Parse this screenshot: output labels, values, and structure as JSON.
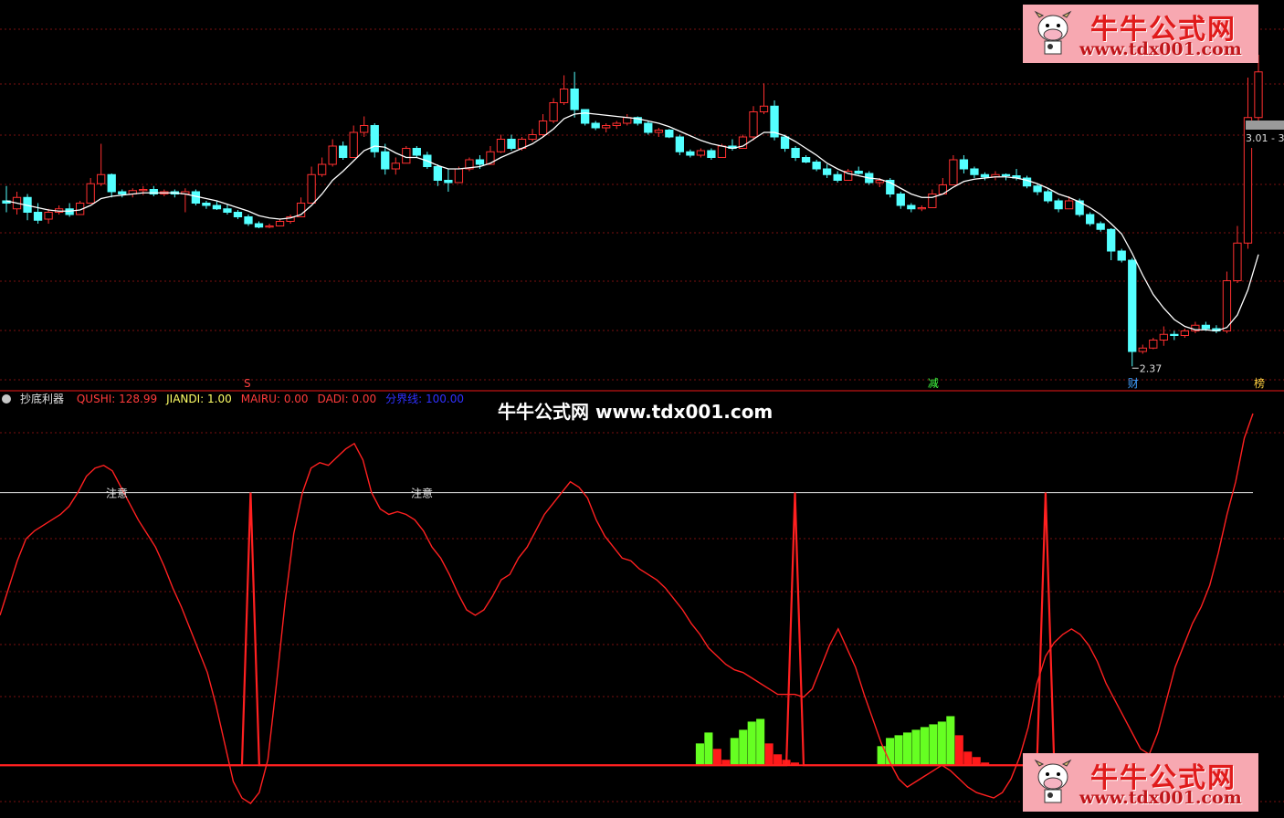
{
  "indicator": {
    "name": "抄底利器",
    "values": [
      {
        "label": "QUSHI: 128.99",
        "color": "#ff3b3b"
      },
      {
        "label": "JIANDI: 1.00",
        "color": "#ffff66"
      },
      {
        "label": "MAIRU: 0.00",
        "color": "#ff3b3b"
      },
      {
        "label": "DADI: 0.00",
        "color": "#ff3b3b"
      },
      {
        "label": "分界线: 100.00",
        "color": "#3030ff"
      }
    ]
  },
  "watermark": "牛牛公式网 www.tdx001.com",
  "logo": {
    "name": "牛牛公式网",
    "url": "www.tdx001.com"
  },
  "price_label": "3.01 - 3",
  "low_label": "2.37",
  "signals": [
    {
      "text": "S",
      "color": "#ff4040"
    },
    {
      "text": "减",
      "color": "#40ff40"
    },
    {
      "text": "财",
      "color": "#40a0ff"
    },
    {
      "text": "榜",
      "color": "#ffd040"
    }
  ],
  "annotations": [
    "注意",
    "注意"
  ],
  "colors": {
    "up": "#ff3030",
    "down": "#54ffff",
    "ma": "#ffffff",
    "grid": "#7a1010",
    "green": "#66ff22"
  },
  "chart_data": [
    {
      "type": "candlestick",
      "title": "",
      "ohlc": [
        [
          3.82,
          3.95,
          3.72,
          3.8
        ],
        [
          3.75,
          3.9,
          3.7,
          3.85
        ],
        [
          3.85,
          3.88,
          3.65,
          3.72
        ],
        [
          3.72,
          3.8,
          3.62,
          3.65
        ],
        [
          3.66,
          3.75,
          3.62,
          3.72
        ],
        [
          3.72,
          3.78,
          3.7,
          3.75
        ],
        [
          3.75,
          3.8,
          3.68,
          3.7
        ],
        [
          3.7,
          3.82,
          3.7,
          3.8
        ],
        [
          3.8,
          4.02,
          3.8,
          3.97
        ],
        [
          3.97,
          4.32,
          3.95,
          4.05
        ],
        [
          4.05,
          4.06,
          3.85,
          3.9
        ],
        [
          3.9,
          3.92,
          3.85,
          3.88
        ],
        [
          3.88,
          3.93,
          3.85,
          3.91
        ],
        [
          3.91,
          3.95,
          3.87,
          3.92
        ],
        [
          3.92,
          3.95,
          3.86,
          3.88
        ],
        [
          3.88,
          3.92,
          3.86,
          3.9
        ],
        [
          3.9,
          3.92,
          3.85,
          3.88
        ],
        [
          3.88,
          3.93,
          3.72,
          3.9
        ],
        [
          3.9,
          3.92,
          3.78,
          3.8
        ],
        [
          3.8,
          3.82,
          3.75,
          3.78
        ],
        [
          3.78,
          3.82,
          3.74,
          3.75
        ],
        [
          3.75,
          3.79,
          3.7,
          3.72
        ],
        [
          3.72,
          3.74,
          3.66,
          3.68
        ],
        [
          3.68,
          3.7,
          3.6,
          3.62
        ],
        [
          3.62,
          3.64,
          3.58,
          3.59
        ],
        [
          3.59,
          3.62,
          3.58,
          3.6
        ],
        [
          3.6,
          3.66,
          3.6,
          3.64
        ],
        [
          3.64,
          3.7,
          3.62,
          3.68
        ],
        [
          3.68,
          3.85,
          3.68,
          3.8
        ],
        [
          3.8,
          4.12,
          3.8,
          4.05
        ],
        [
          4.05,
          4.2,
          4.03,
          4.14
        ],
        [
          4.14,
          4.36,
          4.12,
          4.3
        ],
        [
          4.3,
          4.34,
          4.18,
          4.2
        ],
        [
          4.2,
          4.48,
          4.2,
          4.42
        ],
        [
          4.42,
          4.56,
          4.38,
          4.48
        ],
        [
          4.48,
          4.5,
          4.2,
          4.25
        ],
        [
          4.25,
          4.32,
          4.05,
          4.1
        ],
        [
          4.1,
          4.2,
          4.05,
          4.15
        ],
        [
          4.15,
          4.3,
          4.15,
          4.28
        ],
        [
          4.28,
          4.3,
          4.2,
          4.22
        ],
        [
          4.22,
          4.25,
          4.1,
          4.12
        ],
        [
          4.12,
          4.14,
          3.95,
          4.0
        ],
        [
          4.0,
          4.1,
          3.9,
          3.98
        ],
        [
          3.98,
          4.12,
          3.98,
          4.1
        ],
        [
          4.1,
          4.2,
          4.08,
          4.18
        ],
        [
          4.18,
          4.22,
          4.1,
          4.14
        ],
        [
          4.14,
          4.3,
          4.14,
          4.25
        ],
        [
          4.25,
          4.4,
          4.24,
          4.36
        ],
        [
          4.36,
          4.4,
          4.26,
          4.28
        ],
        [
          4.28,
          4.38,
          4.26,
          4.36
        ],
        [
          4.36,
          4.45,
          4.34,
          4.4
        ],
        [
          4.4,
          4.58,
          4.38,
          4.52
        ],
        [
          4.52,
          4.72,
          4.5,
          4.68
        ],
        [
          4.68,
          4.92,
          4.66,
          4.8
        ],
        [
          4.8,
          4.95,
          4.55,
          4.62
        ],
        [
          4.62,
          4.62,
          4.48,
          4.5
        ],
        [
          4.5,
          4.52,
          4.44,
          4.46
        ],
        [
          4.46,
          4.5,
          4.42,
          4.48
        ],
        [
          4.48,
          4.52,
          4.45,
          4.5
        ],
        [
          4.5,
          4.58,
          4.48,
          4.55
        ],
        [
          4.55,
          4.56,
          4.48,
          4.5
        ],
        [
          4.5,
          4.52,
          4.4,
          4.42
        ],
        [
          4.42,
          4.46,
          4.38,
          4.44
        ],
        [
          4.44,
          4.45,
          4.37,
          4.38
        ],
        [
          4.38,
          4.4,
          4.22,
          4.25
        ],
        [
          4.25,
          4.27,
          4.2,
          4.22
        ],
        [
          4.22,
          4.28,
          4.2,
          4.26
        ],
        [
          4.26,
          4.28,
          4.18,
          4.2
        ],
        [
          4.2,
          4.32,
          4.2,
          4.3
        ],
        [
          4.3,
          4.36,
          4.26,
          4.28
        ],
        [
          4.28,
          4.4,
          4.28,
          4.38
        ],
        [
          4.38,
          4.65,
          4.35,
          4.6
        ],
        [
          4.6,
          4.85,
          4.58,
          4.65
        ],
        [
          4.65,
          4.7,
          4.35,
          4.38
        ],
        [
          4.38,
          4.4,
          4.25,
          4.28
        ],
        [
          4.28,
          4.3,
          4.17,
          4.2
        ],
        [
          4.2,
          4.22,
          4.15,
          4.16
        ],
        [
          4.16,
          4.18,
          4.08,
          4.1
        ],
        [
          4.1,
          4.14,
          4.02,
          4.05
        ],
        [
          4.05,
          4.08,
          3.98,
          4.0
        ],
        [
          4.0,
          4.1,
          4.0,
          4.08
        ],
        [
          4.08,
          4.12,
          4.05,
          4.06
        ],
        [
          4.06,
          4.08,
          3.96,
          3.98
        ],
        [
          3.98,
          4.02,
          3.94,
          4.0
        ],
        [
          4.0,
          4.02,
          3.85,
          3.88
        ],
        [
          3.88,
          3.9,
          3.75,
          3.78
        ],
        [
          3.78,
          3.8,
          3.72,
          3.75
        ],
        [
          3.75,
          3.78,
          3.73,
          3.76
        ],
        [
          3.76,
          3.92,
          3.76,
          3.88
        ],
        [
          3.88,
          4.02,
          3.88,
          3.96
        ],
        [
          3.96,
          4.22,
          3.96,
          4.18
        ],
        [
          4.18,
          4.22,
          4.06,
          4.1
        ],
        [
          4.1,
          4.12,
          4.02,
          4.05
        ],
        [
          4.05,
          4.07,
          4.0,
          4.03
        ],
        [
          4.03,
          4.08,
          4.0,
          4.05
        ],
        [
          4.05,
          4.06,
          4.0,
          4.04
        ],
        [
          4.04,
          4.1,
          4.0,
          4.02
        ],
        [
          4.02,
          4.04,
          3.93,
          3.95
        ],
        [
          3.95,
          3.97,
          3.87,
          3.9
        ],
        [
          3.9,
          3.92,
          3.8,
          3.82
        ],
        [
          3.82,
          3.84,
          3.72,
          3.75
        ],
        [
          3.75,
          3.86,
          3.75,
          3.82
        ],
        [
          3.82,
          3.84,
          3.68,
          3.7
        ],
        [
          3.7,
          3.72,
          3.6,
          3.62
        ],
        [
          3.62,
          3.64,
          3.55,
          3.57
        ],
        [
          3.57,
          3.58,
          3.3,
          3.38
        ],
        [
          3.38,
          3.4,
          3.28,
          3.3
        ],
        [
          3.3,
          3.32,
          2.37,
          2.5
        ],
        [
          2.5,
          2.56,
          2.48,
          2.53
        ],
        [
          2.53,
          2.62,
          2.52,
          2.6
        ],
        [
          2.6,
          2.72,
          2.55,
          2.65
        ],
        [
          2.65,
          2.68,
          2.6,
          2.64
        ],
        [
          2.64,
          2.7,
          2.62,
          2.68
        ],
        [
          2.68,
          2.76,
          2.66,
          2.73
        ],
        [
          2.73,
          2.76,
          2.68,
          2.7
        ],
        [
          2.7,
          2.73,
          2.66,
          2.68
        ],
        [
          2.68,
          3.2,
          2.66,
          3.12
        ],
        [
          3.12,
          3.6,
          3.1,
          3.45
        ],
        [
          3.45,
          4.9,
          3.4,
          4.55
        ],
        [
          4.55,
          5.1,
          4.4,
          4.95
        ]
      ],
      "ma_values": [
        3.82,
        3.8,
        3.78,
        3.76,
        3.74,
        3.73,
        3.73,
        3.74,
        3.78,
        3.84,
        3.86,
        3.87,
        3.88,
        3.89,
        3.89,
        3.89,
        3.89,
        3.88,
        3.86,
        3.84,
        3.82,
        3.79,
        3.76,
        3.73,
        3.69,
        3.67,
        3.66,
        3.67,
        3.7,
        3.78,
        3.88,
        4.0,
        4.08,
        4.17,
        4.26,
        4.3,
        4.29,
        4.24,
        4.2,
        4.2,
        4.17,
        4.13,
        4.1,
        4.1,
        4.11,
        4.12,
        4.15,
        4.2,
        4.24,
        4.28,
        4.32,
        4.38,
        4.45,
        4.54,
        4.58,
        4.59,
        4.58,
        4.57,
        4.56,
        4.55,
        4.54,
        4.52,
        4.5,
        4.47,
        4.43,
        4.39,
        4.35,
        4.32,
        4.3,
        4.28,
        4.3,
        4.36,
        4.42,
        4.42,
        4.39,
        4.34,
        4.28,
        4.22,
        4.15,
        4.1,
        4.06,
        4.04,
        4.02,
        4.01,
        3.98,
        3.93,
        3.88,
        3.85,
        3.85,
        3.88,
        3.94,
        3.99,
        4.01,
        4.02,
        4.03,
        4.03,
        4.02,
        4.0,
        3.97,
        3.93,
        3.88,
        3.85,
        3.81,
        3.76,
        3.7,
        3.62,
        3.53,
        3.36,
        3.17,
        3.0,
        2.88,
        2.78,
        2.72,
        2.69,
        2.69,
        2.68,
        2.71,
        2.82,
        3.04,
        3.35
      ],
      "signal_index": [
        23,
        88,
        107,
        119
      ],
      "ylim": [
        2.3,
        5.1
      ]
    },
    {
      "type": "line",
      "title": "",
      "series": [
        {
          "name": "QUSHI",
          "color": "#ff2020",
          "values": [
            55,
            65,
            75,
            83,
            86,
            88,
            90,
            92,
            95,
            100,
            106,
            109,
            110,
            108,
            102,
            96,
            90,
            85,
            80,
            73,
            65,
            58,
            50,
            42,
            34,
            22,
            8,
            -6,
            -12,
            -14,
            -10,
            2,
            30,
            60,
            85,
            100,
            109,
            111,
            110,
            113,
            116,
            118,
            112,
            100,
            94,
            92,
            93,
            92,
            90,
            86,
            80,
            76,
            70,
            63,
            57,
            55,
            57,
            62,
            68,
            70,
            76,
            80,
            86,
            92,
            96,
            100,
            104,
            102,
            98,
            90,
            84,
            80,
            76,
            75,
            72,
            70,
            68,
            65,
            61,
            57,
            52,
            48,
            43,
            40,
            37,
            35,
            34,
            32,
            30,
            28,
            26,
            26,
            26,
            25,
            28,
            36,
            44,
            50,
            43,
            36,
            26,
            17,
            8,
            1,
            -5,
            -8,
            -6,
            -4,
            -2,
            0,
            -2,
            -5,
            -8,
            -10,
            -11,
            -12,
            -10,
            -5,
            3,
            14,
            30,
            40,
            45,
            48,
            50,
            48,
            44,
            38,
            30,
            24,
            18,
            12,
            6,
            4,
            12,
            24,
            36,
            44,
            52,
            58,
            66,
            78,
            92,
            104,
            120,
            128.99
          ]
        },
        {
          "name": "JIANDI",
          "color": "#ff2020",
          "spike_index": [
            29,
            92,
            121
          ],
          "spike_value": 100
        }
      ],
      "green_bars": [
        {
          "index": 81,
          "value": 8
        },
        {
          "index": 82,
          "value": 12
        },
        {
          "index": 85,
          "value": 10
        },
        {
          "index": 86,
          "value": 13
        },
        {
          "index": 87,
          "value": 16
        },
        {
          "index": 88,
          "value": 17
        },
        {
          "index": 102,
          "value": 7
        },
        {
          "index": 103,
          "value": 10
        },
        {
          "index": 104,
          "value": 11
        },
        {
          "index": 105,
          "value": 12
        },
        {
          "index": 106,
          "value": 13
        },
        {
          "index": 107,
          "value": 14
        },
        {
          "index": 108,
          "value": 15
        },
        {
          "index": 109,
          "value": 16
        },
        {
          "index": 110,
          "value": 18
        }
      ],
      "red_bars": [
        {
          "index": 83,
          "value": 6
        },
        {
          "index": 84,
          "value": 2
        },
        {
          "index": 89,
          "value": 8
        },
        {
          "index": 90,
          "value": 4
        },
        {
          "index": 91,
          "value": 2
        },
        {
          "index": 92,
          "value": 1
        },
        {
          "index": 111,
          "value": 11
        },
        {
          "index": 112,
          "value": 5
        },
        {
          "index": 113,
          "value": 3
        },
        {
          "index": 114,
          "value": 1
        }
      ],
      "threshold": 100,
      "ylim": [
        -15,
        130
      ]
    }
  ]
}
